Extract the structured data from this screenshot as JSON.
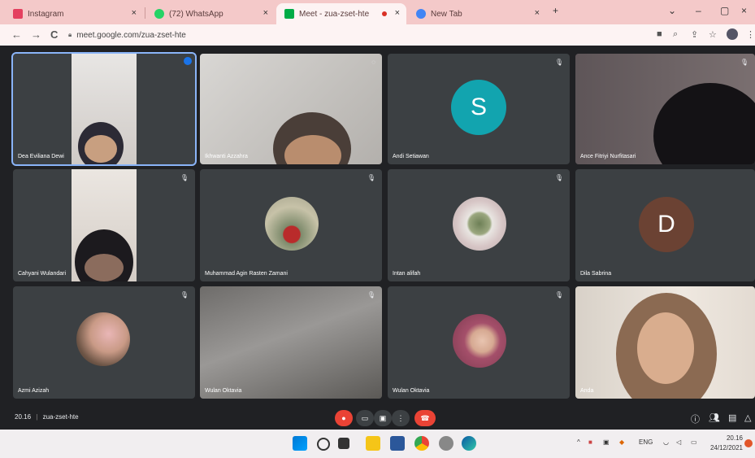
{
  "tabs": [
    {
      "label": "Instagram",
      "close": "×"
    },
    {
      "label": "(72) WhatsApp",
      "close": "×"
    },
    {
      "label": "Meet - zua-zset-hte",
      "close": "×"
    },
    {
      "label": "New Tab",
      "close": "×"
    }
  ],
  "new_tab": "+",
  "window_controls": {
    "dropdown": "⌄",
    "minimize": "–",
    "maximize": "▢",
    "close": "×"
  },
  "toolbar": {
    "back": "←",
    "forward": "→",
    "reload": "C",
    "url": "meet.google.com/zua-zset-hte"
  },
  "participants": [
    {
      "name": "Dea Eviliana Dewi"
    },
    {
      "name": "Ikhwanti Azzahra"
    },
    {
      "name": "Andi Setiawan",
      "initial": "S",
      "color": "#12a4af"
    },
    {
      "name": "Ance Fitriyi Nurfitasari"
    },
    {
      "name": "Cahyani Wulandari"
    },
    {
      "name": "Muhammad Agin Rasten Zamani"
    },
    {
      "name": "Intan alifah"
    },
    {
      "name": "Dila Sabrina",
      "initial": "D",
      "color": "#6b4233"
    },
    {
      "name": "Azmi Azizah"
    },
    {
      "name": "Wulan Oktavia"
    },
    {
      "name": "Wulan Oktavia"
    },
    {
      "name": "Anda"
    }
  ],
  "meeting": {
    "time": "20.16",
    "code": "zua-zset-hte",
    "separator": "|"
  },
  "clock": {
    "time": "20.16",
    "date": "24/12/2021"
  },
  "tray": {
    "lang": "ENG"
  }
}
